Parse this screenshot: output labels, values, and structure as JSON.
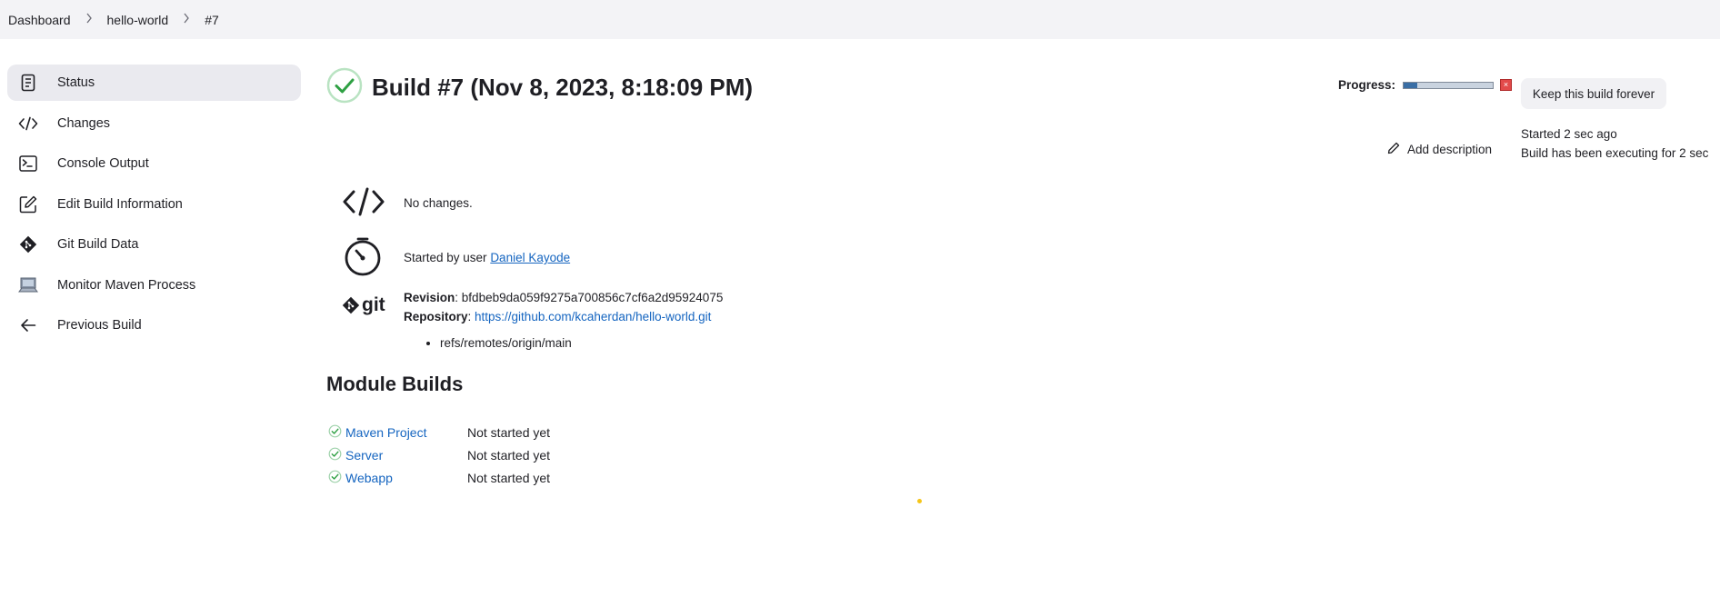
{
  "breadcrumb": {
    "items": [
      "Dashboard",
      "hello-world",
      "#7"
    ]
  },
  "sidebar": {
    "items": [
      {
        "label": "Status",
        "icon": "document-icon"
      },
      {
        "label": "Changes",
        "icon": "code-icon"
      },
      {
        "label": "Console Output",
        "icon": "terminal-icon"
      },
      {
        "label": "Edit Build Information",
        "icon": "edit-icon"
      },
      {
        "label": "Git Build Data",
        "icon": "git-icon"
      },
      {
        "label": "Monitor Maven Process",
        "icon": "computer-icon"
      },
      {
        "label": "Previous Build",
        "icon": "arrow-left-icon"
      }
    ]
  },
  "build": {
    "title": "Build #7 (Nov 8, 2023, 8:18:09 PM)",
    "progress_label": "Progress:",
    "progress_fraction": 0.15,
    "keep_label": "Keep this build forever",
    "add_description": "Add description",
    "started_ago": "Started 2 sec ago",
    "executing_for": "Build has been executing for 2 sec"
  },
  "changes": {
    "text": "No changes."
  },
  "cause": {
    "prefix": "Started by user ",
    "user": "Daniel Kayode"
  },
  "git": {
    "logo_text": "git",
    "revision_label": "Revision",
    "revision": "bfdbeb9da059f9275a700856c7cf6a2d95924075",
    "repository_label": "Repository",
    "repository": "https://github.com/kcaherdan/hello-world.git",
    "refs": [
      "refs/remotes/origin/main"
    ]
  },
  "modules": {
    "title": "Module Builds",
    "items": [
      {
        "name": "Maven Project",
        "status": "Not started yet"
      },
      {
        "name": "Server",
        "status": "Not started yet"
      },
      {
        "name": "Webapp",
        "status": "Not started yet"
      }
    ]
  },
  "colors": {
    "success": "#2ea043",
    "link": "#1565c0",
    "progress_fill": "#3a6ea5",
    "loading_dot": "#f5c518"
  }
}
